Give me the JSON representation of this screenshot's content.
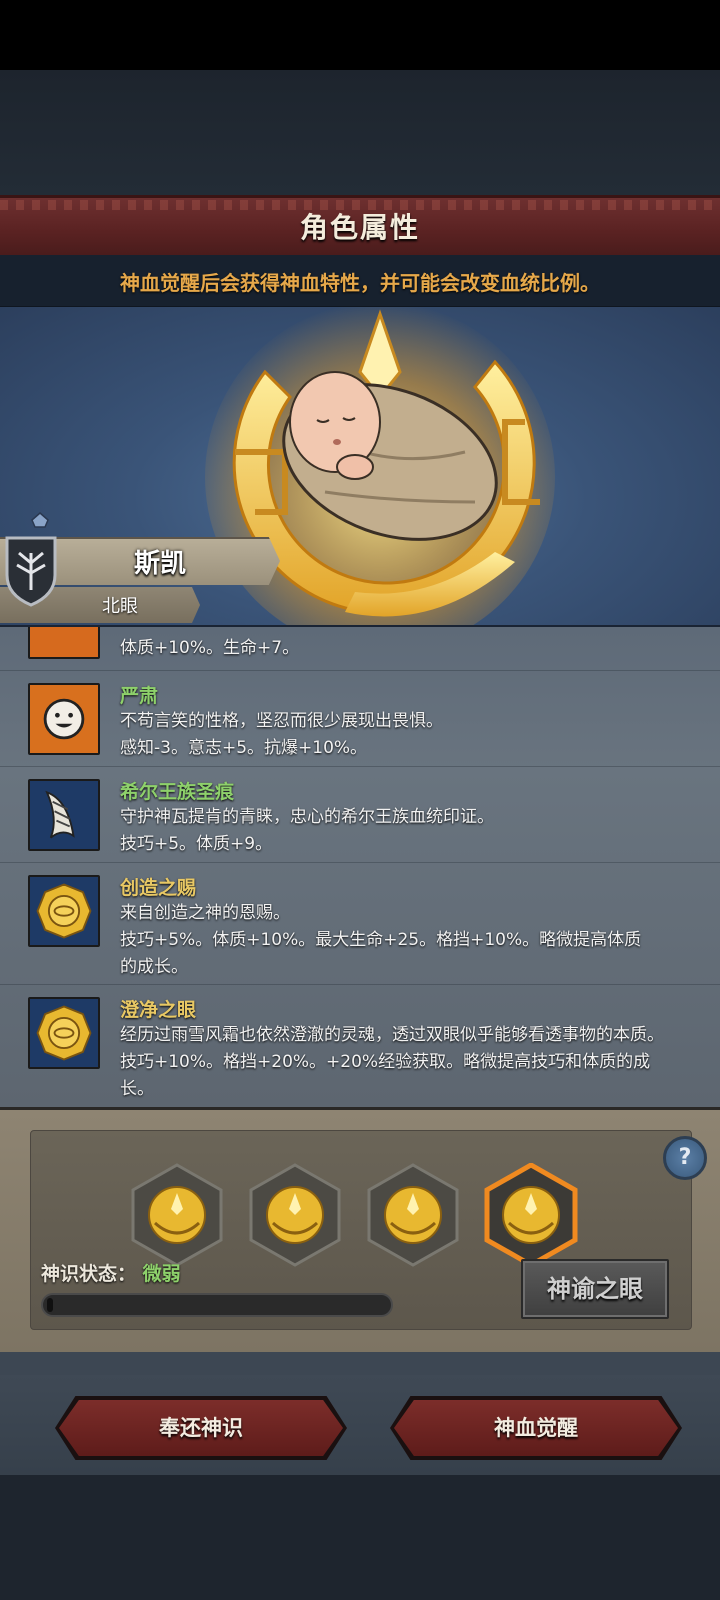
{
  "header": {
    "title": "角色属性",
    "hint": "神血觉醒后会获得神血特性，并可能会改变血统比例。"
  },
  "character": {
    "name": "斯凯",
    "subname": "北眼"
  },
  "traits": {
    "cut_line": "体质+10%。生命+7。",
    "items": [
      {
        "name": "严肃",
        "name_color": "#8ed16b",
        "lines": [
          "不苟言笑的性格，坚忍而很少展现出畏惧。",
          "感知-3。意志+5。抗爆+10%。"
        ],
        "icon": "smiley-face-icon"
      },
      {
        "name": "希尔王族圣痕",
        "name_color": "#8ed16b",
        "lines": [
          "守护神瓦提肯的青睐，忠心的希尔王族血统印证。",
          "技巧+5。体质+9。"
        ],
        "icon": "feather-claw-icon"
      },
      {
        "name": "创造之赐",
        "name_color": "#e8c864",
        "lines": [
          "来自创造之神的恩赐。",
          "技巧+5%。体质+10%。最大生命+25。格挡+10%。略微提高体质",
          "的成长。"
        ],
        "icon": "golden-eye-icon"
      },
      {
        "name": "澄净之眼",
        "name_color": "#e8c864",
        "lines": [
          "经历过雨雪风霜也依然澄澈的灵魂，透过双眼似乎能够看透事物的本质。",
          "技巧+10%。格挡+20%。+20%经验获取。略微提高技巧和体质的成",
          "长。"
        ],
        "icon": "golden-eye-icon"
      }
    ]
  },
  "awakening": {
    "status_label": "神识状态：",
    "status_value": "微弱",
    "progress": 0,
    "oracle_button": "神谕之眼",
    "help_symbol": "?",
    "slots_selected_index": 3
  },
  "actions": {
    "return_button": "奉还神识",
    "awaken_button": "神血觉醒"
  },
  "colors": {
    "accent_gold": "#f0b840",
    "title_red": "#6e3030",
    "status_green": "#8ed16b"
  }
}
